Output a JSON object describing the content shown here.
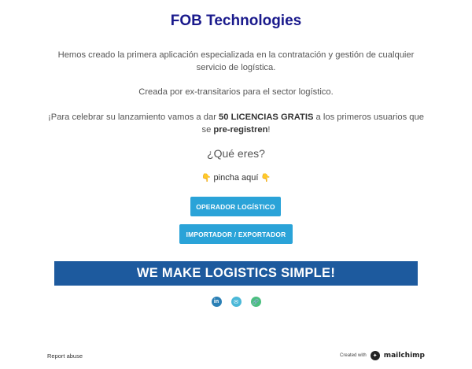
{
  "header": {
    "title": "FOB Technologies"
  },
  "intro": {
    "line1": "Hemos creado la primera aplicación especializada en la contratación y gestión de cualquier servicio de logística.",
    "line2": "Creada por ex-transitarios para el sector logístico.",
    "promo_prefix": "¡Para celebrar su lanzamiento vamos a dar ",
    "promo_bold": "50 LICENCIAS GRATIS",
    "promo_middle": " a los primeros usuarios que se ",
    "promo_bold2": "pre-registren",
    "promo_suffix": "!"
  },
  "question": "¿Qué eres?",
  "pincha": {
    "label": "pincha aquí",
    "icon": "pointing-down-hand-icon",
    "icon_glyph": "👇"
  },
  "buttons": {
    "operador": "OPERADOR LOGÍSTICO",
    "importador": "IMPORTADOR / EXPORTADOR",
    "color": "#2aa3d8"
  },
  "banner": {
    "text": "WE MAKE LOGISTICS SIMPLE!",
    "color": "#1d5a9e"
  },
  "social": [
    {
      "name": "linkedin-icon",
      "glyph": "in"
    },
    {
      "name": "email-icon",
      "glyph": "✉"
    },
    {
      "name": "link-icon",
      "glyph": "🔗"
    }
  ],
  "footer": {
    "report": "Report abuse",
    "created_with": "Created with",
    "brand": "mailchimp"
  }
}
